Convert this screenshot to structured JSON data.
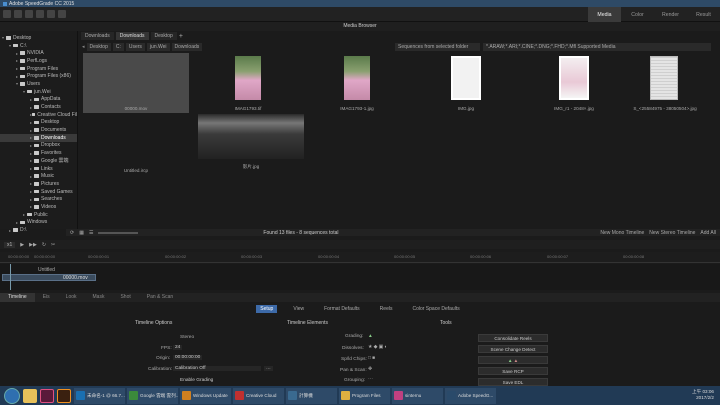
{
  "window": {
    "title": "Adobe SpeedGrade CC 2015"
  },
  "pages": [
    "Media",
    "Color",
    "Render",
    "Result"
  ],
  "media_browser": {
    "title": "Media Browser",
    "tabs": [
      "Downloads",
      "Downloads",
      "Desktop"
    ],
    "path": [
      "Desktop",
      "C:",
      "Users",
      "jun.Wei",
      "Downloads"
    ],
    "filter_mode": "Sequences from selected folder",
    "filter_types": "*.ARAW;*.ARI;*.CINE;*.DNG;*.FHD;*.Mfl Supported Media"
  },
  "tree": [
    {
      "label": "Desktop",
      "indent": 0,
      "arrow": "▾"
    },
    {
      "label": "C:\\",
      "indent": 1,
      "arrow": "▾"
    },
    {
      "label": "NVIDIA",
      "indent": 2,
      "arrow": "▸"
    },
    {
      "label": "PerfLogs",
      "indent": 2,
      "arrow": "▸"
    },
    {
      "label": "Program Files",
      "indent": 2,
      "arrow": "▸"
    },
    {
      "label": "Program Files (x86)",
      "indent": 2,
      "arrow": "▸"
    },
    {
      "label": "Users",
      "indent": 2,
      "arrow": "▾"
    },
    {
      "label": "jun.Wei",
      "indent": 3,
      "arrow": "▾"
    },
    {
      "label": "AppData",
      "indent": 4,
      "arrow": "▸"
    },
    {
      "label": "Contacts",
      "indent": 4,
      "arrow": "▸"
    },
    {
      "label": "Creative Cloud Fil",
      "indent": 4,
      "arrow": "▸"
    },
    {
      "label": "Desktop",
      "indent": 4,
      "arrow": "▸"
    },
    {
      "label": "Documents",
      "indent": 4,
      "arrow": "▸"
    },
    {
      "label": "Downloads",
      "indent": 4,
      "arrow": "▸",
      "selected": true
    },
    {
      "label": "Dropbox",
      "indent": 4,
      "arrow": "▸"
    },
    {
      "label": "Favorites",
      "indent": 4,
      "arrow": "▸"
    },
    {
      "label": "Google 雲端",
      "indent": 4,
      "arrow": "▸"
    },
    {
      "label": "Links",
      "indent": 4,
      "arrow": "▸"
    },
    {
      "label": "Music",
      "indent": 4,
      "arrow": "▸"
    },
    {
      "label": "Pictures",
      "indent": 4,
      "arrow": "▸"
    },
    {
      "label": "Saved Games",
      "indent": 4,
      "arrow": "▸"
    },
    {
      "label": "Searches",
      "indent": 4,
      "arrow": "▸"
    },
    {
      "label": "Videos",
      "indent": 4,
      "arrow": "▸"
    },
    {
      "label": "Public",
      "indent": 3,
      "arrow": "▸"
    },
    {
      "label": "Windows",
      "indent": 2,
      "arrow": "▸"
    },
    {
      "label": "D:\\",
      "indent": 1,
      "arrow": "▸"
    }
  ],
  "files": [
    {
      "name": "00000.mov"
    },
    {
      "name": "IMAG1793.tif"
    },
    {
      "name": "IMAG1793-1.jpg"
    },
    {
      "name": "IMG.jpg"
    },
    {
      "name": "IMG_r1 - 2048×.jpg"
    },
    {
      "name": "S_<25584975 - 38050504>.jpg"
    },
    {
      "name": "Untitled.ircp"
    },
    {
      "name": "影片.jpg"
    }
  ],
  "status": {
    "found": "Found 13 files - 8 sequences total",
    "new_mono": "New Mono Timeline",
    "new_stereo": "New Stereo Timeline",
    "add_all": "Add All"
  },
  "timeline": {
    "zoom": "x1",
    "ticks": [
      "00:00:00:00",
      "00:00:00:00",
      "00:00:00:01",
      "00:00:00:02",
      "00:00:00:03",
      "00:00:00:04",
      "00:00:00:05",
      "00:00:00:06",
      "00:00:00:07",
      "00:00:00:08"
    ],
    "track_label": "Untitled",
    "clip_label": "00000.mov"
  },
  "bottom_tabs": [
    "Timeline",
    "Eis",
    "Look",
    "Mask",
    "Shot",
    "Pan & Scan"
  ],
  "sub_tabs": [
    "Setup",
    "View",
    "Format Defaults",
    "Reels",
    "Color Space Defaults"
  ],
  "timeline_options": {
    "header": "Timeline Options",
    "stereo": "Stereo",
    "fps_label": "FPS:",
    "fps": "24",
    "origin_label": "Origin:",
    "origin": "00:00:00:00",
    "calibration_label": "Calibration:",
    "calibration": "Calibration Off",
    "enable_grading": "Enable Grading"
  },
  "timeline_elements": {
    "header": "Timeline Elements",
    "grading": "Grading:",
    "dissolves": "Dissolves:",
    "sp_chips": "Sp/ld Chips:",
    "pan_scan": "Pan & Scan:",
    "grouping": "Grouping:"
  },
  "tools": {
    "header": "Tools",
    "buttons": [
      "Consolidate Reels",
      "Scene Change Detect",
      "",
      "Save RCP",
      "Save EDL"
    ]
  },
  "taskbar": {
    "items": [
      "未命名-1 @ 66.7...",
      "Google 雲端 雲列...",
      "Windows Update",
      "Creative Cloud",
      "計算機",
      "Program Files",
      "sinternu",
      "Adobe SpeedG..."
    ],
    "time": "上午 03:06",
    "date": "2017/2/2"
  }
}
